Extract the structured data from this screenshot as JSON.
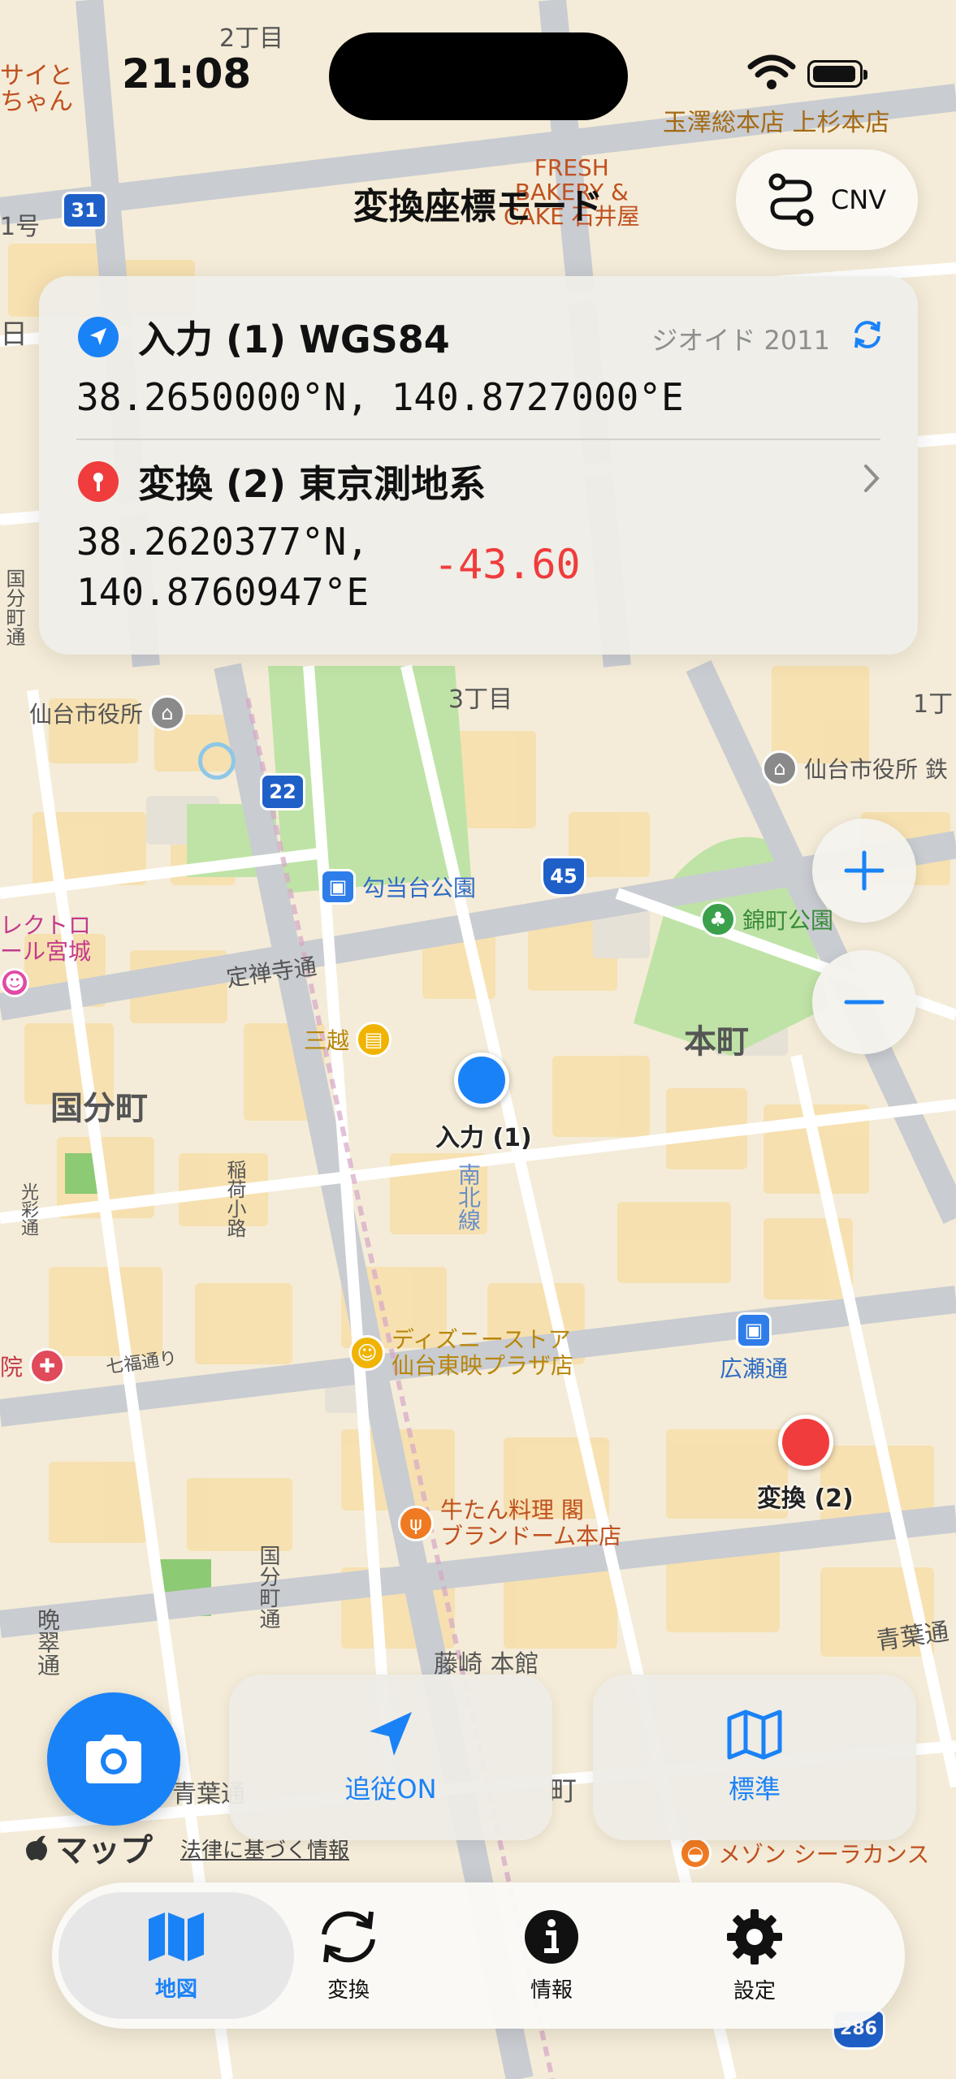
{
  "status_bar": {
    "time": "21:08"
  },
  "header": {
    "title": "変換座標モード",
    "cnv_label": "CNV"
  },
  "card": {
    "input": {
      "label": "入力 (1) WGS84",
      "geoid": "ジオイド 2011",
      "coords": "38.2650000°N, 140.8727000°E"
    },
    "converted": {
      "label": "変換 (2) 東京測地系",
      "lat": "38.2620377°N,",
      "lon": "140.8760947°E",
      "height_diff": "-43.60"
    }
  },
  "map": {
    "markers": {
      "input_label": "入力 (1)",
      "converted_label": "変換 (2)"
    },
    "labels": {
      "chome2": "2丁目",
      "chome3": "3丁目",
      "chome1": "1丁",
      "kokubuncho": "国分町",
      "honcho": "本町",
      "jozenji": "定禅寺通",
      "nanboku": "南北線",
      "kokubuncho_dori": "国分町通",
      "inari": "稲荷小路",
      "nanakita": "七福通り",
      "aoba": "青葉通",
      "aoba2": "青葉通",
      "bansui": "晩翠通",
      "koseido": "光彩通",
      "r1": "1号",
      "nichi": "日",
      "kokubun_v": "国分町通",
      "tamazawa": "玉澤総本店 上杉本店",
      "fresh": "FRESH\nBAKERY &\nCAKE 石井屋",
      "sendai_city": "仙台市役所",
      "sendai_city2": "仙台市役所 鉄",
      "koutoudai": "勾当台公園",
      "nishikicho": "錦町公園",
      "mitsukoshi": "三越",
      "disney": "ディズニーストア\n仙台東映プラザ店",
      "hirosedori": "広瀬通",
      "gyutan": "牛たん料理 閣\nブランドーム本店",
      "fujisaki": "藤崎 本館",
      "electro": "レクトロ\nール宮城",
      "maison": "メゾン シーラカンス",
      "route31": "31",
      "route22": "22",
      "route45": "45",
      "route286": "286",
      "saito": "サイと\nちゃん",
      "in": "院",
      "machi": "町"
    }
  },
  "controls": {
    "follow_label": "追従ON",
    "map_type_label": "標準",
    "apple_maps": "マップ",
    "legal": "法律に基づく情報"
  },
  "tabs": [
    {
      "label": "地図"
    },
    {
      "label": "変換"
    },
    {
      "label": "情報"
    },
    {
      "label": "設定"
    }
  ],
  "colors": {
    "accent": "#1a82f7",
    "red": "#f03c3c"
  }
}
